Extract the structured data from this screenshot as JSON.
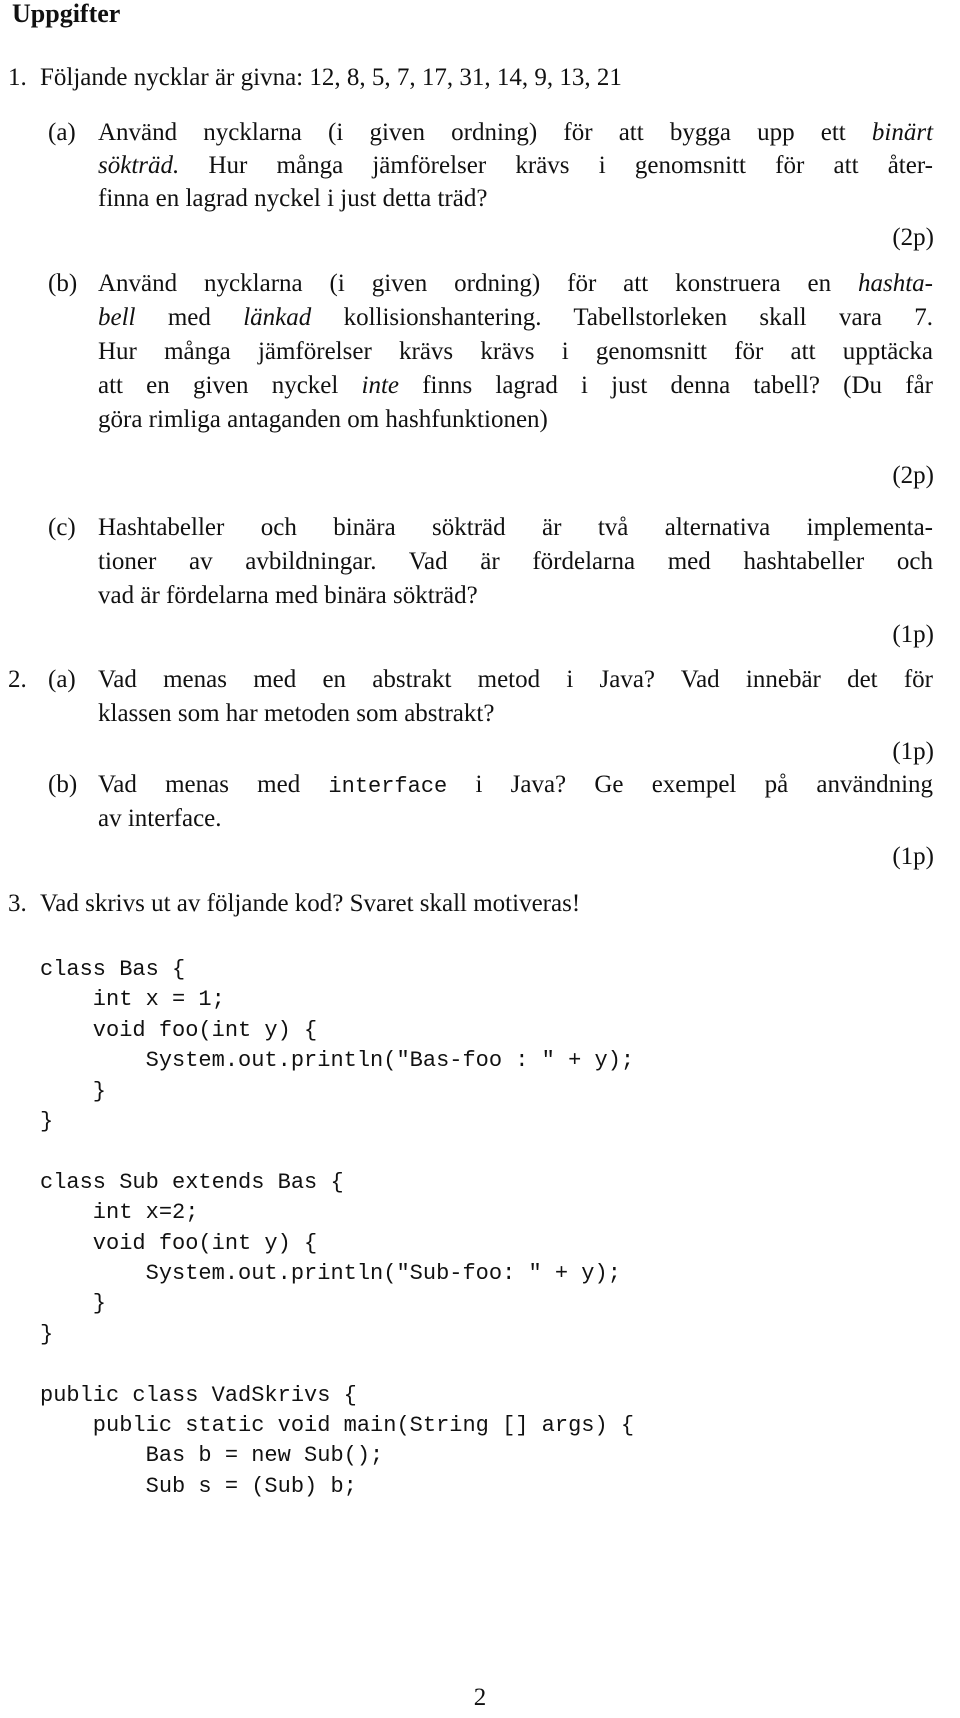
{
  "page": {
    "heading": "Uppgifter",
    "page_number": "2"
  },
  "q1": {
    "number": "1.",
    "intro": "Följande nycklar är givna: 12, 8, 5, 7, 17, 31, 14, 9, 13, 21",
    "a": {
      "label": "(a)",
      "line1_pre": "Använd nycklarna (i given ordning) för att bygga upp ett",
      "line1_em": "binärt",
      "line2_em": "sökträd.",
      "line2_post": "Hur många jämförelser krävs i genomsnitt för att åter-",
      "line3": "finna en lagrad nyckel i just detta träd?",
      "points": "(2p)"
    },
    "b": {
      "label": "(b)",
      "line1_pre": "Använd nycklarna (i given ordning) för att konstruera en",
      "line1_em": "hashta-",
      "line2_em1": "bell",
      "line2_mid": "med",
      "line2_em2": "länkad",
      "line2_post": "kollisionshantering. Tabellstorleken skall vara 7.",
      "line3": "Hur många jämförelser krävs krävs i genomsnitt för att upptäcka",
      "line4_pre": "att en given nyckel",
      "line4_em": "inte",
      "line4_post": "finns lagrad i just denna tabell? (Du får",
      "line5": "göra rimliga antaganden om hashfunktionen)",
      "points": "(2p)"
    },
    "c": {
      "label": "(c)",
      "line1": "Hashtabeller och binära sökträd är två alternativa implementa-",
      "line2": "tioner av avbildningar. Vad är fördelarna med hashtabeller och",
      "line3": "vad är fördelarna med binära sökträd?",
      "points": "(1p)"
    }
  },
  "q2": {
    "number": "2.",
    "a": {
      "label": "(a)",
      "line1": "Vad menas med en abstrakt metod i Java? Vad innebär det för",
      "line2": "klassen som har metoden som abstrakt?",
      "points": "(1p)"
    },
    "b": {
      "label": "(b)",
      "line1_pre": "Vad menas med",
      "line1_code": "interface",
      "line1_post": "i Java? Ge exempel på användning",
      "line2": "av interface.",
      "points": "(1p)"
    }
  },
  "q3": {
    "number": "3.",
    "text": "Vad skrivs ut av följande kod? Svaret skall motiveras!",
    "code_lines": [
      "class Bas {",
      "    int x = 1;",
      "    void foo(int y) {",
      "        System.out.println(\"Bas-foo : \" + y);",
      "    }",
      "}",
      "",
      "class Sub extends Bas {",
      "    int x=2;",
      "    void foo(int y) {",
      "        System.out.println(\"Sub-foo: \" + y);",
      "    }",
      "}",
      "",
      "public class VadSkrivs {",
      "    public static void main(String [] args) {",
      "        Bas b = new Sub();",
      "        Sub s = (Sub) b;"
    ]
  }
}
